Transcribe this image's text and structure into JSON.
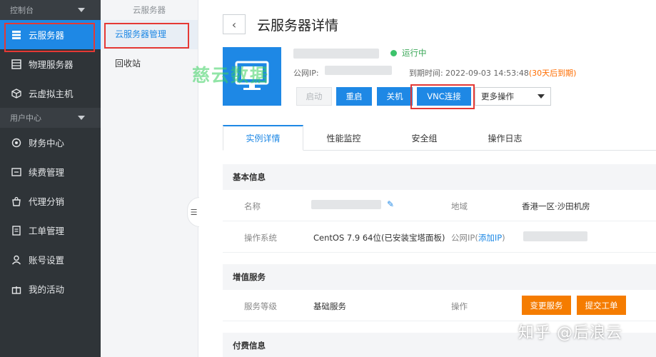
{
  "sidebar": {
    "section1": "控制台",
    "items1": [
      {
        "label": "云服务器",
        "icon": "server-list-icon"
      },
      {
        "label": "物理服务器",
        "icon": "grid-icon"
      },
      {
        "label": "云虚拟主机",
        "icon": "cube-icon"
      }
    ],
    "section2": "用户中心",
    "items2": [
      {
        "label": "财务中心",
        "icon": "coin-icon"
      },
      {
        "label": "续费管理",
        "icon": "renew-icon"
      },
      {
        "label": "代理分销",
        "icon": "handbag-icon"
      },
      {
        "label": "工单管理",
        "icon": "ticket-icon"
      },
      {
        "label": "账号设置",
        "icon": "user-icon"
      },
      {
        "label": "我的活动",
        "icon": "gift-icon"
      }
    ]
  },
  "subnav": {
    "title": "云服务器",
    "items": [
      "云服务器管理",
      "回收站"
    ]
  },
  "header": {
    "back": "‹",
    "title": "云服务器详情"
  },
  "summary": {
    "status": "运行中",
    "ip_label": "公网IP:",
    "expire_label": "到期时间:",
    "expire_value": "2022-09-03 14:53:48",
    "expire_note": "(30天后到期)",
    "colors": {
      "accent": "#1e88e5",
      "running": "#3cc36b",
      "warn": "#ff6d00"
    }
  },
  "actions": {
    "start": "启动",
    "restart": "重启",
    "shutdown": "关机",
    "vnc": "VNC连接",
    "more": "更多操作"
  },
  "watermark": "慈云数据",
  "tabs": [
    "实例详情",
    "性能监控",
    "安全组",
    "操作日志"
  ],
  "basic": {
    "heading": "基本信息",
    "name_label": "名称",
    "region_label": "地域",
    "region_value": "香港一区·沙田机房",
    "os_label": "操作系统",
    "os_value": "CentOS 7.9 64位(已安装宝塔面板)",
    "pubip_label": "公网IP(",
    "pubip_link": "添加IP",
    "pubip_close": ")"
  },
  "value_added": {
    "heading": "增值服务",
    "level_label": "服务等级",
    "level_value": "基础服务",
    "op_label": "操作",
    "change_btn": "变更服务",
    "ticket_btn": "提交工单"
  },
  "paid": {
    "heading": "付费信息"
  },
  "zhihu_mark": "知乎 @后浪云"
}
